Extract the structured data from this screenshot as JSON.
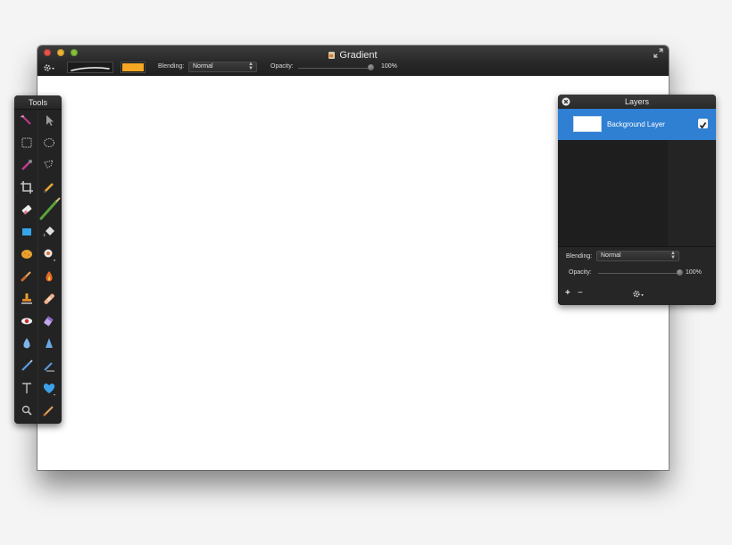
{
  "window": {
    "title": "Gradient"
  },
  "toolbar": {
    "blending_label": "Blending:",
    "blending_value": "Normal",
    "opacity_label": "Opacity:",
    "opacity_value": "100%",
    "opacity_level": 1.0,
    "color": "#f5a623"
  },
  "tools": {
    "title": "Tools",
    "items": [
      "magic-wand-icon",
      "arrow-pointer-icon",
      "rect-select-icon",
      "ellipse-select-icon",
      "color-picker-icon",
      "lasso-icon",
      "crop-icon",
      "pencil-icon",
      "eraser-icon",
      "paintbrush-icon",
      "rect-shape-icon",
      "paint-bucket-icon",
      "sponge-icon",
      "spray-icon",
      "smudge-icon",
      "burn-icon",
      "stamp-icon",
      "bandage-icon",
      "red-eye-icon",
      "gradient-eraser-icon",
      "blur-drop-icon",
      "sharpen-icon",
      "pen-icon",
      "vector-pen-icon",
      "text-icon",
      "heart-shape-icon",
      "zoom-icon",
      "brush-tool-icon"
    ]
  },
  "layers": {
    "title": "Layers",
    "items": [
      {
        "name": "Background Layer",
        "visible": true,
        "selected": true
      }
    ],
    "blending_label": "Blending:",
    "blending_value": "Normal",
    "opacity_label": "Opacity:",
    "opacity_value": "100%",
    "opacity_level": 1.0,
    "add_icon": "+",
    "remove_icon": "−"
  },
  "colors": {
    "selection": "#2f7fd3",
    "panel": "#1c1c1c",
    "accent_color_well": "#f5a623"
  }
}
